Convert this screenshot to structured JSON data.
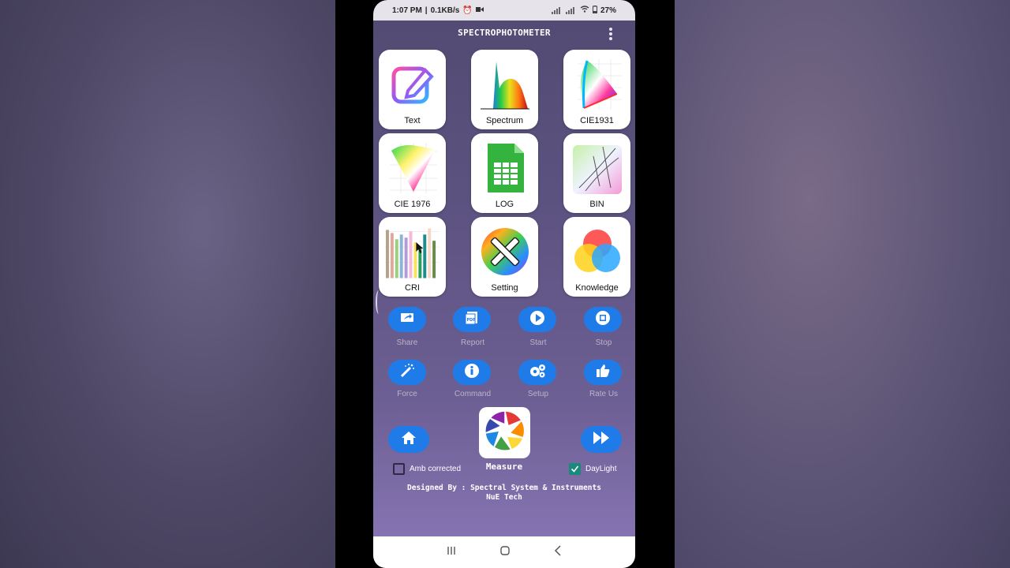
{
  "status": {
    "time": "1:07 PM",
    "speed": "0.1KB/s",
    "battery": "27%"
  },
  "app": {
    "title": "SPECTROPHOTOMETER"
  },
  "tiles": [
    {
      "label": "Text",
      "icon": "edit-text-icon"
    },
    {
      "label": "Spectrum",
      "icon": "spectrum-icon"
    },
    {
      "label": "CIE1931",
      "icon": "cie1931-chart-icon"
    },
    {
      "label": "CIE 1976",
      "icon": "cie1976-chart-icon"
    },
    {
      "label": "LOG",
      "icon": "spreadsheet-icon"
    },
    {
      "label": "BIN",
      "icon": "bin-chart-icon"
    },
    {
      "label": "CRI",
      "icon": "cri-bars-icon"
    },
    {
      "label": "Setting",
      "icon": "tools-icon"
    },
    {
      "label": "Knowledge",
      "icon": "color-circles-icon"
    }
  ],
  "actions_row1": [
    {
      "label": "Share",
      "icon": "share-icon"
    },
    {
      "label": "Report",
      "icon": "pdf-icon"
    },
    {
      "label": "Start",
      "icon": "play-icon"
    },
    {
      "label": "Stop",
      "icon": "stop-icon"
    }
  ],
  "actions_row2": [
    {
      "label": "Force",
      "icon": "magic-wand-icon"
    },
    {
      "label": "Command",
      "icon": "info-icon"
    },
    {
      "label": "Setup",
      "icon": "gears-icon"
    },
    {
      "label": "Rate Us",
      "icon": "thumbs-up-icon"
    }
  ],
  "measure": {
    "label": "Measure",
    "icon": "aperture-icon"
  },
  "home": {
    "icon": "home-icon"
  },
  "forward": {
    "icon": "fast-forward-icon"
  },
  "checkboxes": {
    "amb": {
      "label": "Amb corrected",
      "checked": false
    },
    "daylight": {
      "label": "DayLight",
      "checked": true
    }
  },
  "credit": {
    "line1": "Designed By : Spectral System & Instruments",
    "line2": "NuE Tech"
  },
  "colors": {
    "button_blue": "#1f7be8",
    "checkbox_teal": "#1a8a7c"
  }
}
